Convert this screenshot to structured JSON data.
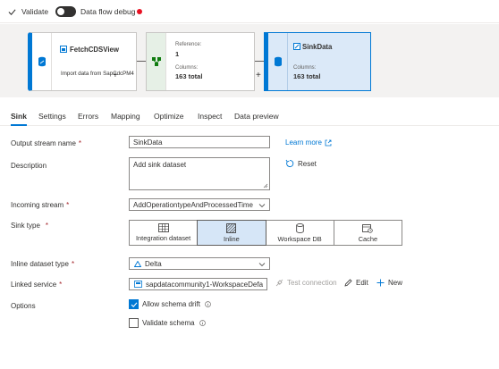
{
  "toolbar": {
    "validate_label": "Validate",
    "debug_label": "Data flow debug",
    "debug_status_color": "#e81123"
  },
  "canvas": {
    "source": {
      "title": "FetchCDSView",
      "description": "Import data from SapCdcPM4",
      "icon": "database-icon"
    },
    "transform": {
      "reference_label": "Reference:",
      "reference_value": "1",
      "columns_label": "Columns:",
      "columns_value": "163 total",
      "icon": "transform-icon"
    },
    "sink": {
      "title": "SinkData",
      "columns_label": "Columns:",
      "columns_value": "163 total",
      "icon": "sink-database-icon"
    },
    "plus_glyph": "+"
  },
  "tabs": [
    {
      "label": "Sink",
      "active": true
    },
    {
      "label": "Settings"
    },
    {
      "label": "Errors"
    },
    {
      "label": "Mapping"
    },
    {
      "label": "Optimize"
    },
    {
      "label": "Inspect"
    },
    {
      "label": "Data preview"
    }
  ],
  "form": {
    "output_stream": {
      "label": "Output stream name",
      "required": "*",
      "value": "SinkData"
    },
    "learn_more": "Learn more",
    "description": {
      "label": "Description",
      "value": "Add sink dataset"
    },
    "reset": "Reset",
    "incoming_stream": {
      "label": "Incoming stream",
      "required": "*",
      "value": "AddOperationtypeAndProcessedTime"
    },
    "sink_type": {
      "label": "Sink type",
      "required": "*",
      "options": [
        {
          "label": "Integration dataset",
          "icon": "table-icon"
        },
        {
          "label": "Inline",
          "icon": "inline-icon",
          "selected": true
        },
        {
          "label": "Workspace DB",
          "icon": "database-icon"
        },
        {
          "label": "Cache",
          "icon": "cache-icon"
        }
      ]
    },
    "inline_dataset_type": {
      "label": "Inline dataset type",
      "required": "*",
      "value": "Delta",
      "icon": "delta-icon"
    },
    "linked_service": {
      "label": "Linked service",
      "required": "*",
      "value": "sapdatacommunity1-WorkspaceDefa",
      "test_connection": "Test connection",
      "edit": "Edit",
      "new": "New"
    },
    "options": {
      "label": "Options",
      "allow_schema_drift": {
        "label": "Allow schema drift",
        "checked": true
      },
      "validate_schema": {
        "label": "Validate schema",
        "checked": false
      }
    }
  },
  "colors": {
    "accent": "#0078d4",
    "selected_bg": "#d6e6f7",
    "required": "#a4262c"
  }
}
